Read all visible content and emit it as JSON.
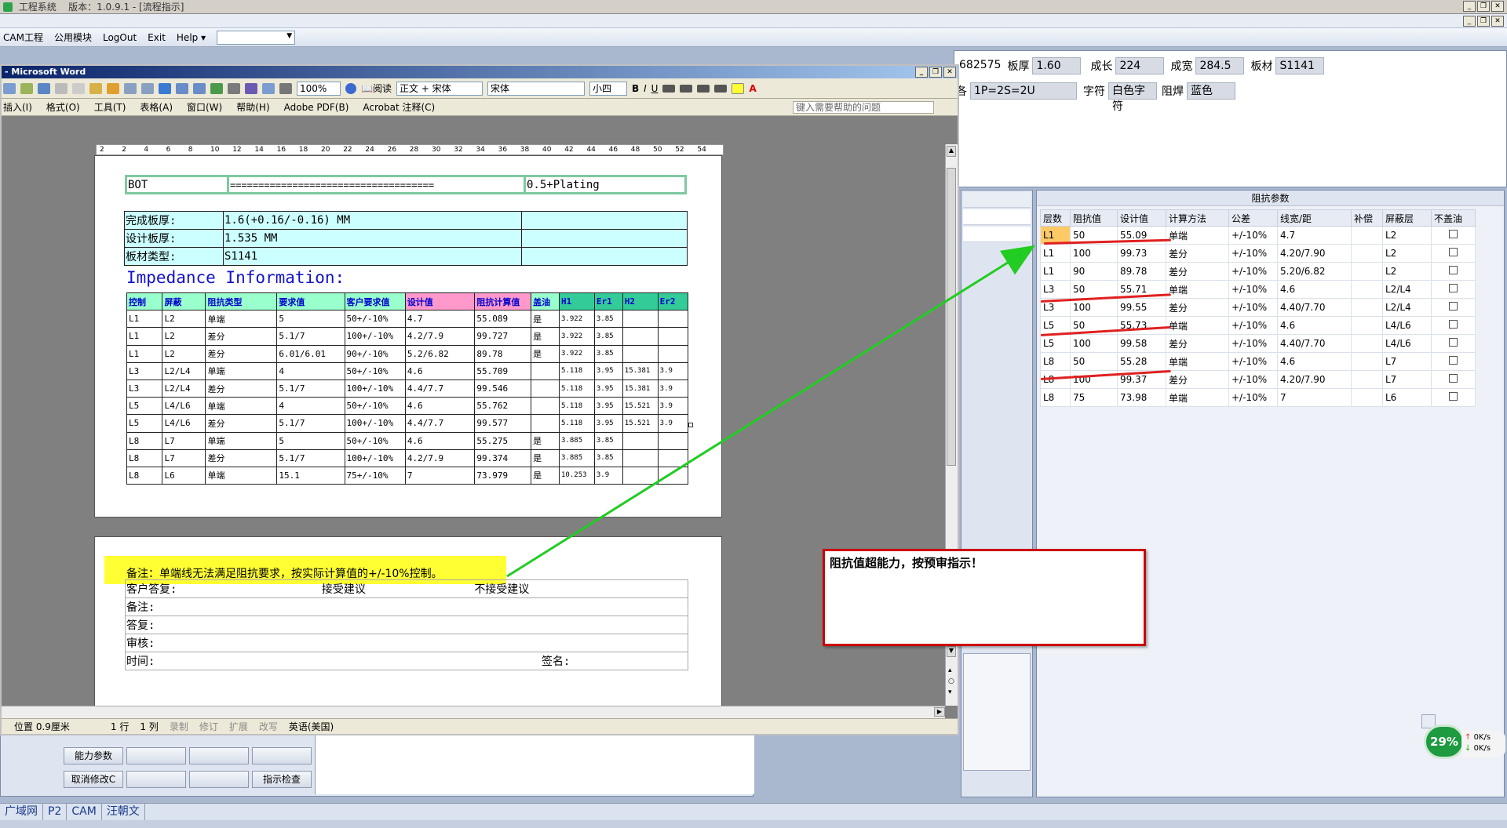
{
  "app": {
    "title": "工程系统",
    "version": "版本：1.0.9.1 - [流程指示]",
    "menu": [
      "CAM工程",
      "公用模块",
      "LogOut",
      "Exit",
      "Help"
    ]
  },
  "info": {
    "partial_number": "682575",
    "board_thickness_label": "板厚",
    "board_thickness": "1.60",
    "growth_label": "成长",
    "growth": "224",
    "finish_label": "成宽",
    "finish": "284.5",
    "material_label": "板材",
    "material": "S1141",
    "stack_label": "各",
    "stack": "1P=2S=2U",
    "char_label": "字符",
    "char": "白色字符",
    "mask_label": "阻焊",
    "mask": "蓝色"
  },
  "impedance_panel": {
    "title": "阻抗参数",
    "headers": [
      "层数",
      "阻抗值",
      "设计值",
      "计算方法",
      "公差",
      "线宽/距",
      "补偿",
      "屏蔽层",
      "不盖油"
    ],
    "rows": [
      [
        "L1",
        "50",
        "55.09",
        "单端",
        "+/-10%",
        "4.7",
        "",
        "L2"
      ],
      [
        "L1",
        "100",
        "99.73",
        "差分",
        "+/-10%",
        "4.20/7.90",
        "",
        "L2"
      ],
      [
        "L1",
        "90",
        "89.78",
        "差分",
        "+/-10%",
        "5.20/6.82",
        "",
        "L2"
      ],
      [
        "L3",
        "50",
        "55.71",
        "单端",
        "+/-10%",
        "4.6",
        "",
        "L2/L4"
      ],
      [
        "L3",
        "100",
        "99.55",
        "差分",
        "+/-10%",
        "4.40/7.70",
        "",
        "L2/L4"
      ],
      [
        "L5",
        "50",
        "55.73",
        "单端",
        "+/-10%",
        "4.6",
        "",
        "L4/L6"
      ],
      [
        "L5",
        "100",
        "99.58",
        "差分",
        "+/-10%",
        "4.40/7.70",
        "",
        "L4/L6"
      ],
      [
        "L8",
        "50",
        "55.28",
        "单端",
        "+/-10%",
        "4.6",
        "",
        "L7"
      ],
      [
        "L8",
        "100",
        "99.37",
        "差分",
        "+/-10%",
        "4.20/7.90",
        "",
        "L7"
      ],
      [
        "L8",
        "75",
        "73.98",
        "单端",
        "+/-10%",
        "7",
        "",
        "L6"
      ]
    ]
  },
  "buttons": {
    "cap_params": "能力参数",
    "cancel_edit": "取消修改C",
    "check": "指示检查"
  },
  "bottom_tabs": [
    "广域网",
    "P2",
    "CAM",
    "汪朝文"
  ],
  "net_widget": {
    "percent": "29%",
    "up": "0K/s",
    "down": "0K/s"
  },
  "word": {
    "title": "Microsoft Word",
    "zoom": "100%",
    "read": "阅读",
    "style": "正文 + 宋体",
    "font": "宋体",
    "size": "小四",
    "menu": [
      "插入(I)",
      "格式(O)",
      "工具(T)",
      "表格(A)",
      "窗口(W)",
      "帮助(H)",
      "Adobe PDF(B)",
      "Acrobat 注释(C)"
    ],
    "help_placeholder": "键入需要帮助的问题",
    "ruler_ticks": [
      "2",
      "2",
      "4",
      "6",
      "8",
      "10",
      "12",
      "14",
      "16",
      "18",
      "20",
      "22",
      "24",
      "26",
      "28",
      "30",
      "32",
      "34",
      "36",
      "38",
      "40",
      "42",
      "44",
      "46",
      "48",
      "50",
      "52",
      "54"
    ],
    "status": {
      "position": "位置 0.9厘米",
      "line": "1 行",
      "col": "1 列",
      "rec": "录制",
      "trk": "修订",
      "ext": "扩展",
      "ovr": "改写",
      "lang": "英语(美国)"
    }
  },
  "doc": {
    "bot_row": [
      "BOT",
      "====================================",
      "0.5+Plating"
    ],
    "finish_thickness_label": "完成板厚:",
    "finish_thickness": "1.6(+0.16/-0.16) MM",
    "design_thickness_label": "设计板厚:",
    "design_thickness": "1.535 MM",
    "material_label": "板材类型:",
    "material": "S1141",
    "impedance_title": "Impedance Information:",
    "imp_headers": [
      "控制",
      "屏蔽",
      "阻抗类型",
      "要求值",
      "客户要求值",
      "设计值",
      "阻抗计算值",
      "盖油",
      "H1",
      "Er1",
      "H2",
      "Er2"
    ],
    "imp_rows": [
      [
        "L1",
        "L2",
        "单端",
        "5",
        "50+/-10%",
        "4.7",
        "55.089",
        "是",
        "3.922",
        "3.85",
        "",
        ""
      ],
      [
        "L1",
        "L2",
        "差分",
        "5.1/7",
        "100+/-10%",
        "4.2/7.9",
        "99.727",
        "是",
        "3.922",
        "3.85",
        "",
        ""
      ],
      [
        "L1",
        "L2",
        "差分",
        "6.01/6.01",
        "90+/-10%",
        "5.2/6.82",
        "89.78",
        "是",
        "3.922",
        "3.85",
        "",
        ""
      ],
      [
        "L3",
        "L2/L4",
        "单端",
        "4",
        "50+/-10%",
        "4.6",
        "55.709",
        "",
        "5.118",
        "3.95",
        "15.381",
        "3.9"
      ],
      [
        "L3",
        "L2/L4",
        "差分",
        "5.1/7",
        "100+/-10%",
        "4.4/7.7",
        "99.546",
        "",
        "5.118",
        "3.95",
        "15.381",
        "3.9"
      ],
      [
        "L5",
        "L4/L6",
        "单端",
        "4",
        "50+/-10%",
        "4.6",
        "55.762",
        "",
        "5.118",
        "3.95",
        "15.521",
        "3.9"
      ],
      [
        "L5",
        "L4/L6",
        "差分",
        "5.1/7",
        "100+/-10%",
        "4.4/7.7",
        "99.577",
        "",
        "5.118",
        "3.95",
        "15.521",
        "3.9"
      ],
      [
        "L8",
        "L7",
        "单端",
        "5",
        "50+/-10%",
        "4.6",
        "55.275",
        "是",
        "3.885",
        "3.85",
        "",
        ""
      ],
      [
        "L8",
        "L7",
        "差分",
        "5.1/7",
        "100+/-10%",
        "4.2/7.9",
        "99.374",
        "是",
        "3.885",
        "3.85",
        "",
        ""
      ],
      [
        "L8",
        "L6",
        "单端",
        "15.1",
        "75+/-10%",
        "7",
        "73.979",
        "是",
        "10.253",
        "3.9",
        "",
        ""
      ]
    ],
    "remark_note": "备注：单端线无法满足阻抗要求，按实际计算值的+/-10%控制。",
    "customer_reply_label": "客户答复:",
    "accept": "接受建议",
    "reject": "不接受建议",
    "remark_label": "备注:",
    "reply_label": "答复:",
    "review_label": "审核:",
    "time_label": "时间:",
    "sign_label": "签名:"
  },
  "callout": "阻抗值超能力，按预审指示！",
  "colors": {
    "arrow": "#22cc22",
    "underline": "#e02020",
    "callout_border": "#cc0000",
    "highlight": "#ffff33"
  }
}
